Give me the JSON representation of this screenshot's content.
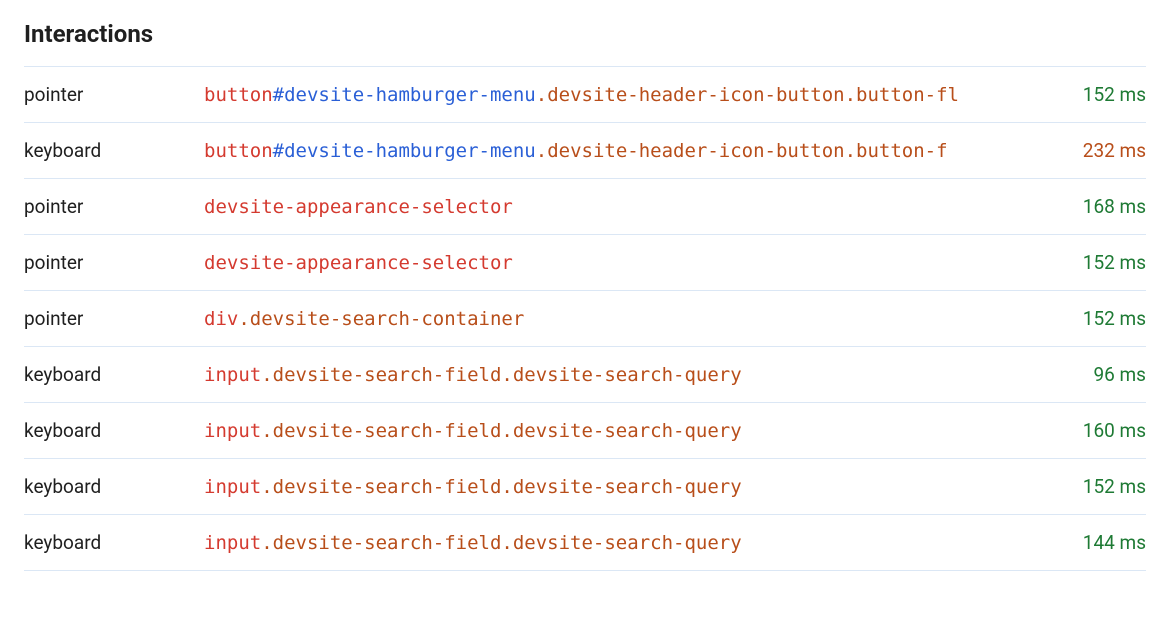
{
  "title": "Interactions",
  "colors": {
    "element": "#d43a2f",
    "id": "#2a5fd6",
    "class": "#b84e1a",
    "timeGood": "#1e7a34",
    "timeWarn": "#b84e1a"
  },
  "rows": [
    {
      "type": "pointer",
      "selector": [
        {
          "kind": "element",
          "text": "button"
        },
        {
          "kind": "id",
          "text": "#devsite-hamburger-menu"
        },
        {
          "kind": "class",
          "text": ".devsite-header-icon-button.button-fl"
        }
      ],
      "time_ms": 152,
      "time_status": "good"
    },
    {
      "type": "keyboard",
      "selector": [
        {
          "kind": "element",
          "text": "button"
        },
        {
          "kind": "id",
          "text": "#devsite-hamburger-menu"
        },
        {
          "kind": "class",
          "text": ".devsite-header-icon-button.button-f"
        }
      ],
      "time_ms": 232,
      "time_status": "warn"
    },
    {
      "type": "pointer",
      "selector": [
        {
          "kind": "element",
          "text": "devsite-appearance-selector"
        }
      ],
      "time_ms": 168,
      "time_status": "good"
    },
    {
      "type": "pointer",
      "selector": [
        {
          "kind": "element",
          "text": "devsite-appearance-selector"
        }
      ],
      "time_ms": 152,
      "time_status": "good"
    },
    {
      "type": "pointer",
      "selector": [
        {
          "kind": "element",
          "text": "div"
        },
        {
          "kind": "class",
          "text": ".devsite-search-container"
        }
      ],
      "time_ms": 152,
      "time_status": "good"
    },
    {
      "type": "keyboard",
      "selector": [
        {
          "kind": "element",
          "text": "input"
        },
        {
          "kind": "class",
          "text": ".devsite-search-field.devsite-search-query"
        }
      ],
      "time_ms": 96,
      "time_status": "good"
    },
    {
      "type": "keyboard",
      "selector": [
        {
          "kind": "element",
          "text": "input"
        },
        {
          "kind": "class",
          "text": ".devsite-search-field.devsite-search-query"
        }
      ],
      "time_ms": 160,
      "time_status": "good"
    },
    {
      "type": "keyboard",
      "selector": [
        {
          "kind": "element",
          "text": "input"
        },
        {
          "kind": "class",
          "text": ".devsite-search-field.devsite-search-query"
        }
      ],
      "time_ms": 152,
      "time_status": "good"
    },
    {
      "type": "keyboard",
      "selector": [
        {
          "kind": "element",
          "text": "input"
        },
        {
          "kind": "class",
          "text": ".devsite-search-field.devsite-search-query"
        }
      ],
      "time_ms": 144,
      "time_status": "good"
    }
  ]
}
